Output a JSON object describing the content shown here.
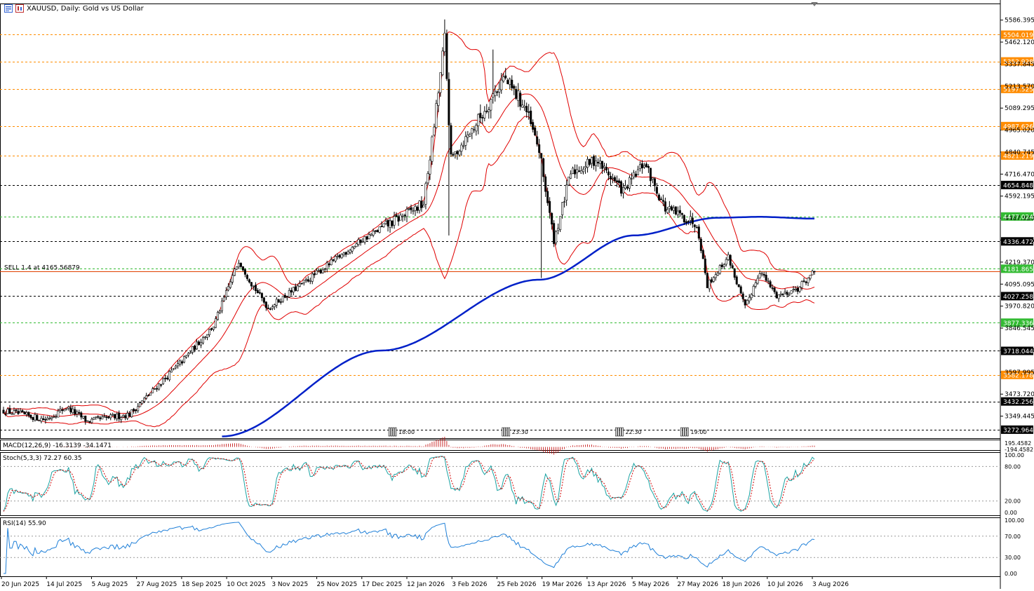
{
  "header": {
    "title": "XAUUSD, Daily:  Gold vs US Dollar",
    "icons": [
      "chart-window-icon",
      "chart-type-icon"
    ]
  },
  "colors": {
    "background": "#ffffff",
    "grid_panel": "#f7f7f7",
    "bull": "#000000",
    "bear": "#000000",
    "bollinger": "#e00000",
    "ma200": "#0020c8",
    "level_orange": "#ff8c00",
    "level_green": "#33bb33",
    "level_black": "#000000",
    "macd": "#c00000",
    "stoch_main": "#1aa3a3",
    "stoch_signal": "#d00000",
    "rsi": "#1e7fd8"
  },
  "trade": {
    "label": "SELL 1.4 at 4165.56879",
    "price": 4165.56879
  },
  "price_axis": {
    "ticks": [
      "5586.395",
      "5462.120",
      "5337.845",
      "5213.570",
      "5089.295",
      "4965.020",
      "4840.745",
      "4716.470",
      "4592.195",
      "4467.920",
      "4343.645",
      "4219.370",
      "4095.095",
      "3970.820",
      "3846.545",
      "3722.270",
      "3597.995",
      "3473.720",
      "3349.445"
    ],
    "range": [
      3225,
      5680
    ]
  },
  "levels": [
    {
      "price": 5504.019,
      "label": "5504.019",
      "style": "orange"
    },
    {
      "price": 5352.928,
      "label": "5352.928",
      "style": "orange"
    },
    {
      "price": 5197.525,
      "label": "5197.525",
      "style": "orange"
    },
    {
      "price": 4987.626,
      "label": "4987.626",
      "style": "orange"
    },
    {
      "price": 4821.219,
      "label": "4821.219",
      "style": "orange"
    },
    {
      "price": 4654.848,
      "label": "4654.848",
      "style": "black"
    },
    {
      "price": 4477.024,
      "label": "4477.024",
      "style": "green"
    },
    {
      "price": 4336.472,
      "label": "4336.472",
      "style": "black"
    },
    {
      "price": 4181.865,
      "label": "4181.865",
      "style": "green"
    },
    {
      "price": 4027.258,
      "label": "4027.258",
      "style": "black"
    },
    {
      "price": 3877.336,
      "label": "3877.336",
      "style": "green"
    },
    {
      "price": 3718.044,
      "label": "3718.044",
      "style": "black"
    },
    {
      "price": 3582.178,
      "label": "3582.178",
      "style": "orange"
    },
    {
      "price": 3432.256,
      "label": "3432.256",
      "style": "black"
    },
    {
      "price": 3272.964,
      "label": "3272.964",
      "style": "black"
    }
  ],
  "x_axis": {
    "labels": [
      "20 Jun 2025",
      "14 Jul 2025",
      "5 Aug 2025",
      "27 Aug 2025",
      "18 Sep 2025",
      "10 Oct 2025",
      "3 Nov 2025",
      "25 Nov 2025",
      "17 Dec 2025",
      "12 Jan 2026",
      "3 Feb 2026",
      "25 Feb 2026",
      "19 Mar 2026",
      "13 Apr 2026",
      "5 May 2026",
      "27 May 2026",
      "18 Jun 2026",
      "10 Jul 2026",
      "3 Aug 2026"
    ]
  },
  "event_markers": [
    {
      "label": "18:00",
      "bar": 186
    },
    {
      "label": "23:30",
      "bar": 240
    },
    {
      "label": "22:30",
      "bar": 294
    },
    {
      "label": "19:00",
      "bar": 325
    }
  ],
  "indicators": {
    "macd": {
      "label": "MACD(12,26,9) -16.3139 -34.1471",
      "axis_top": "195.4582",
      "axis_bottom": "-194.4582"
    },
    "stoch": {
      "label": "Stoch(5,3,3) 72.27 60.35",
      "ticks": [
        "100.00",
        "80.00",
        "20.00",
        "0.00"
      ]
    },
    "rsi": {
      "label": "RSI(14) 55.90",
      "ticks": [
        "100.00",
        "70.00",
        "30.00",
        "0.00"
      ]
    }
  },
  "chart_data": {
    "type": "candlestick",
    "symbol": "XAUUSD",
    "timeframe": "Daily",
    "title": "XAUUSD, Daily:  Gold vs US Dollar",
    "ylim": [
      3225,
      5680
    ],
    "bar_count": 387,
    "anchors": [
      {
        "bar": 0,
        "price": 3380
      },
      {
        "bar": 20,
        "price": 3330
      },
      {
        "bar": 30,
        "price": 3400
      },
      {
        "bar": 40,
        "price": 3320
      },
      {
        "bar": 60,
        "price": 3360
      },
      {
        "bar": 85,
        "price": 3660
      },
      {
        "bar": 100,
        "price": 3860
      },
      {
        "bar": 112,
        "price": 4230
      },
      {
        "bar": 118,
        "price": 4100
      },
      {
        "bar": 126,
        "price": 3960
      },
      {
        "bar": 145,
        "price": 4120
      },
      {
        "bar": 170,
        "price": 4340
      },
      {
        "bar": 200,
        "price": 4550
      },
      {
        "bar": 206,
        "price": 5080
      },
      {
        "bar": 210,
        "price": 5480
      },
      {
        "bar": 213,
        "price": 4800
      },
      {
        "bar": 225,
        "price": 5000
      },
      {
        "bar": 238,
        "price": 5260
      },
      {
        "bar": 248,
        "price": 5100
      },
      {
        "bar": 255,
        "price": 4850
      },
      {
        "bar": 262,
        "price": 4340
      },
      {
        "bar": 270,
        "price": 4720
      },
      {
        "bar": 282,
        "price": 4800
      },
      {
        "bar": 295,
        "price": 4620
      },
      {
        "bar": 305,
        "price": 4780
      },
      {
        "bar": 315,
        "price": 4520
      },
      {
        "bar": 330,
        "price": 4440
      },
      {
        "bar": 335,
        "price": 4090
      },
      {
        "bar": 345,
        "price": 4250
      },
      {
        "bar": 353,
        "price": 3960
      },
      {
        "bar": 360,
        "price": 4170
      },
      {
        "bar": 368,
        "price": 4030
      },
      {
        "bar": 378,
        "price": 4070
      },
      {
        "bar": 386,
        "price": 4165
      }
    ],
    "ma200": [
      {
        "bar": 104,
        "price": 3235
      },
      {
        "bar": 180,
        "price": 3720
      },
      {
        "bar": 255,
        "price": 4120
      },
      {
        "bar": 300,
        "price": 4370
      },
      {
        "bar": 340,
        "price": 4470
      },
      {
        "bar": 360,
        "price": 4475
      },
      {
        "bar": 386,
        "price": 4465
      }
    ],
    "bollinger": {
      "period": 20,
      "deviation": 2
    },
    "last_close": 4165.56879
  }
}
